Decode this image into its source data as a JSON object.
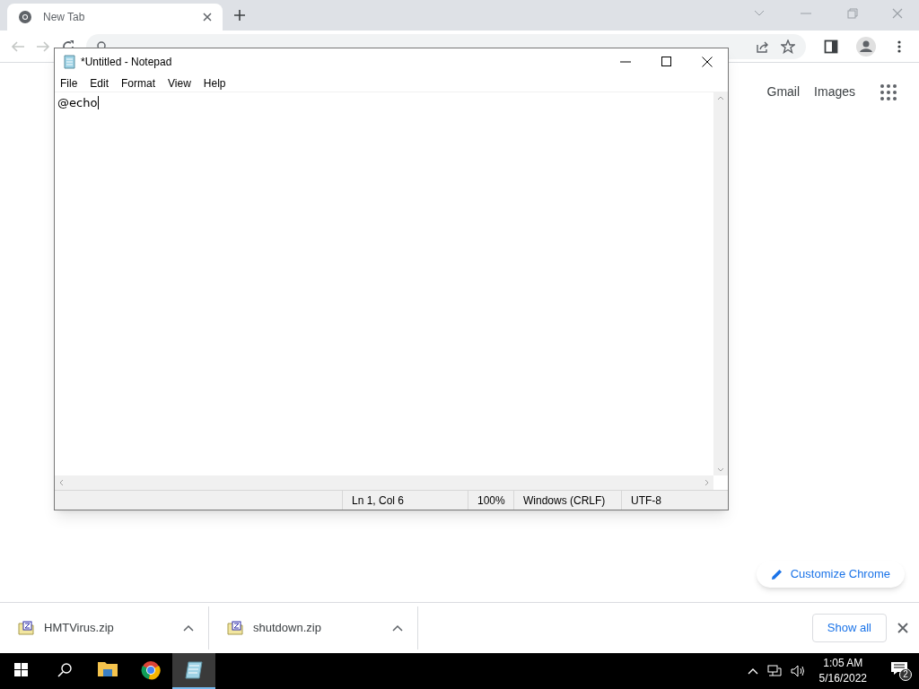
{
  "browser": {
    "tabs": [
      {
        "title": "New Tab",
        "selected": true
      }
    ],
    "header_links": [
      "Gmail",
      "Images"
    ],
    "customize_button": "Customize Chrome"
  },
  "notepad": {
    "title": "*Untitled - Notepad",
    "menu": [
      "File",
      "Edit",
      "Format",
      "View",
      "Help"
    ],
    "text": "@echo",
    "status_bar": [
      "Ln 1, Col 6",
      "100%",
      "Windows (CRLF)",
      "UTF-8"
    ]
  },
  "downloads": {
    "items": [
      {
        "name": "HMTVirus.zip"
      },
      {
        "name": "shutdown.zip"
      }
    ],
    "show_all": "Show all"
  },
  "taskbar": {
    "apps": [
      {
        "kind": "start",
        "selected": false
      },
      {
        "kind": "search",
        "selected": false
      },
      {
        "kind": "explorer",
        "selected": false
      },
      {
        "kind": "chrome",
        "selected": false
      },
      {
        "kind": "notepad",
        "selected": true
      }
    ],
    "time": "1:05 AM",
    "date": "5/16/2022",
    "notifications": "2"
  }
}
